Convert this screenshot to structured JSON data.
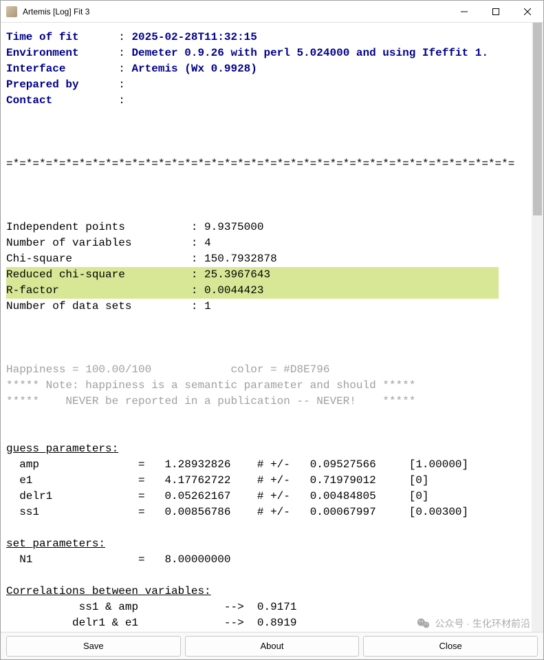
{
  "window": {
    "title": "Artemis [Log] Fit 3"
  },
  "header": {
    "time_label": "Time of fit",
    "time_value": "2025-02-28T11:32:15",
    "env_label": "Environment",
    "env_value": "Demeter 0.9.26 with perl 5.024000 and using Ifeffit 1.",
    "interface_label": "Interface",
    "interface_value": "Artemis (Wx 0.9928)",
    "prepared_label": "Prepared by",
    "prepared_value": "",
    "contact_label": "Contact",
    "contact_value": ""
  },
  "separator": "=*=*=*=*=*=*=*=*=*=*=*=*=*=*=*=*=*=*=*=*=*=*=*=*=*=*=*=*=*=*=*=*=*=*=*=*=*=*=",
  "stats": {
    "independent_label": "Independent points",
    "independent_value": "9.9375000",
    "nvars_label": "Number of variables",
    "nvars_value": "4",
    "chisq_label": "Chi-square",
    "chisq_value": "150.7932878",
    "redchisq_label": "Reduced chi-square",
    "redchisq_value": "25.3967643",
    "rfactor_label": "R-factor",
    "rfactor_value": "0.0044423",
    "ndatasets_label": "Number of data sets",
    "ndatasets_value": "1"
  },
  "happiness_line": "Happiness = 100.00/100            color = #D8E796",
  "note_line1": "***** Note: happiness is a semantic parameter and should *****",
  "note_line2": "*****    NEVER be reported in a publication -- NEVER!    *****",
  "guess_header": "guess parameters:",
  "guess": [
    {
      "name": "amp",
      "value": "1.28932826",
      "pm": "0.09527566",
      "init": "[1.00000]"
    },
    {
      "name": "e1",
      "value": "4.17762722",
      "pm": "0.71979012",
      "init": "[0]"
    },
    {
      "name": "delr1",
      "value": "0.05262167",
      "pm": "0.00484805",
      "init": "[0]"
    },
    {
      "name": "ss1",
      "value": "0.00856786",
      "pm": "0.00067997",
      "init": "[0.00300]"
    }
  ],
  "set_header": "set parameters:",
  "set": [
    {
      "name": "N1",
      "value": "8.00000000"
    }
  ],
  "corr_header": "Correlations between variables:",
  "corr": [
    {
      "pair": "ss1 & amp",
      "arrow": "-->",
      "value": "0.9171"
    },
    {
      "pair": "delr1 & e1",
      "arrow": "-->",
      "value": "0.8919"
    }
  ],
  "buttons": {
    "save": "Save",
    "about": "About",
    "close": "Close"
  },
  "watermark": "公众号 · 生化环材前沿"
}
